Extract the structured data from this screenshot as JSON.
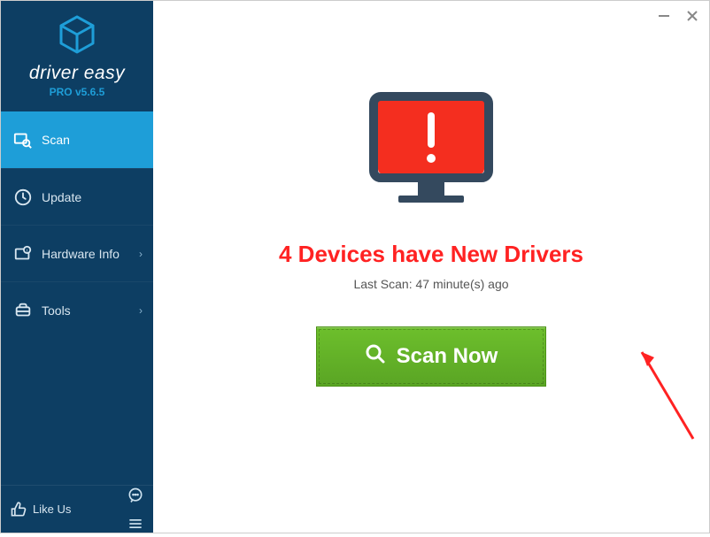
{
  "brand": {
    "name": "driver easy",
    "version_label": "PRO v5.6.5"
  },
  "sidebar": {
    "items": [
      {
        "label": "Scan",
        "icon": "scan-icon",
        "has_sub": false
      },
      {
        "label": "Update",
        "icon": "update-icon",
        "has_sub": false
      },
      {
        "label": "Hardware Info",
        "icon": "hardware-icon",
        "has_sub": true
      },
      {
        "label": "Tools",
        "icon": "tools-icon",
        "has_sub": true
      }
    ],
    "like_label": "Like Us"
  },
  "main": {
    "headline": "4 Devices have New Drivers",
    "last_scan": "Last Scan: 47 minute(s) ago",
    "scan_button": "Scan Now"
  },
  "colors": {
    "sidebar_bg": "#0d3e63",
    "active_bg": "#1e9ed8",
    "alert_red": "#f22",
    "scan_green": "#62b127"
  }
}
